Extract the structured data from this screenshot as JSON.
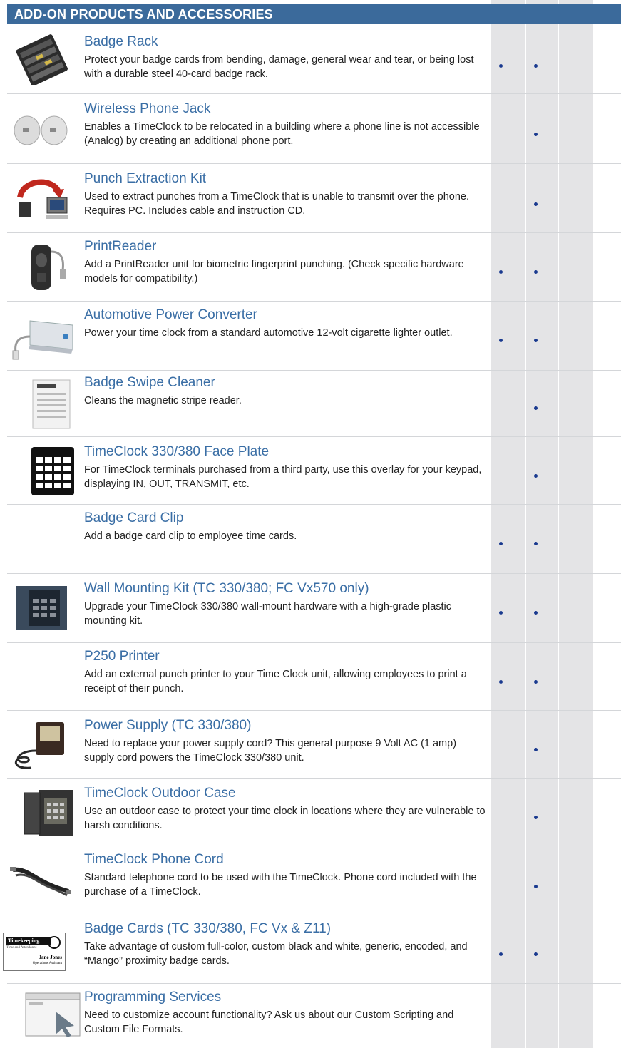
{
  "header": {
    "title": "ADD-ON PRODUCTS AND  ACCESSORIES"
  },
  "products": [
    {
      "title": "Badge Rack",
      "description": "Protect your badge cards from bending, damage, general wear and tear, or being lost with a durable steel 40-card badge rack.",
      "icon": "badge-rack-icon",
      "col1": true,
      "col2": true
    },
    {
      "title": "Wireless Phone Jack",
      "description": "Enables a TimeClock to be relocated in a building where a phone line is not accessible (Analog) by creating an additional phone port.",
      "icon": "phone-jack-icon",
      "col1": false,
      "col2": true
    },
    {
      "title": "Punch Extraction Kit",
      "description": "Used to extract punches from a TimeClock that is unable to transmit over the phone. Requires PC. Includes cable and instruction CD.",
      "icon": "extraction-kit-icon",
      "col1": false,
      "col2": true
    },
    {
      "title": "PrintReader",
      "description": "Add a PrintReader unit for biometric fingerprint punching. (Check specific hardware models for compatibility.)",
      "icon": "fingerprint-reader-icon",
      "col1": true,
      "col2": true
    },
    {
      "title": "Automotive Power Converter",
      "description": "Power your time clock from a standard automotive 12-volt cigarette lighter outlet.",
      "icon": "power-converter-icon",
      "col1": true,
      "col2": true
    },
    {
      "title": "Badge Swipe Cleaner",
      "description": "Cleans the magnetic stripe reader.",
      "icon": "cleaner-packet-icon",
      "col1": false,
      "col2": true
    },
    {
      "title": "TimeClock 330/380 Face Plate",
      "description": "For TimeClock terminals purchased from a third party, use this overlay for your keypad, displaying IN, OUT, TRANSMIT, etc.",
      "icon": "face-plate-icon",
      "col1": false,
      "col2": true
    },
    {
      "title": "Badge Card Clip",
      "description": "Add a badge card clip to employee time cards.",
      "icon": "",
      "col1": true,
      "col2": true
    },
    {
      "title": "Wall Mounting Kit (TC 330/380; FC Vx570 only)",
      "description": "Upgrade your TimeClock 330/380 wall-mount hardware with a high-grade plastic mounting kit.",
      "icon": "wall-mount-kit-icon",
      "col1": true,
      "col2": true
    },
    {
      "title": "P250 Printer",
      "description": "Add an external punch printer to your Time Clock unit, allowing employees to print a receipt of their punch.",
      "icon": "",
      "col1": true,
      "col2": true
    },
    {
      "title": "Power Supply (TC 330/380)",
      "description": "Need to replace your power supply cord?  This general purpose 9 Volt AC (1 amp) supply cord powers the TimeClock 330/380 unit.",
      "icon": "power-supply-icon",
      "col1": false,
      "col2": true
    },
    {
      "title": "TimeClock Outdoor Case",
      "description": "Use an outdoor case to protect your time clock in locations where they are vulnerable to harsh conditions.",
      "icon": "outdoor-case-icon",
      "col1": false,
      "col2": true
    },
    {
      "title": "TimeClock Phone Cord",
      "description": "Standard telephone cord to be used with the TimeClock. Phone cord included with the purchase of a TimeClock.",
      "icon": "phone-cord-icon",
      "col1": false,
      "col2": true
    },
    {
      "title": "Badge Cards (TC 330/380, FC Vx & Z11)",
      "description": "Take advantage of custom full-color, custom black and white, generic, encoded,  and “Mango” proximity badge cards.",
      "icon": "badge-card-icon",
      "col1": true,
      "col2": true
    },
    {
      "title": "Programming Services",
      "description": "Need to customize account functionality? Ask us about our Custom Scripting and Custom File Formats.",
      "icon": "programming-window-icon",
      "col1": false,
      "col2": false
    }
  ],
  "badge_card_art": {
    "brand": "Timekeeping",
    "tagline": "Time and Attendance",
    "name": "Jane Jones",
    "role": "Operations Assistant"
  },
  "colors": {
    "header": "#3b6a9b",
    "title": "#3a6ea5",
    "dot": "#1a3a8f",
    "column": "#e4e4e6"
  }
}
